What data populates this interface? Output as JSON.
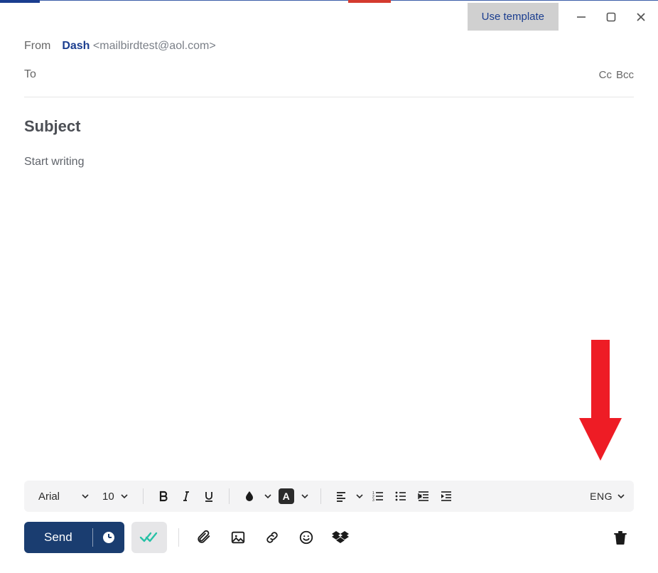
{
  "titlebar": {
    "use_template": "Use template"
  },
  "from": {
    "label": "From",
    "name": "Dash",
    "email": "<mailbirdtest@aol.com>"
  },
  "to": {
    "label": "To",
    "cc": "Cc",
    "bcc": "Bcc"
  },
  "subject": {
    "placeholder": "Subject"
  },
  "body": {
    "placeholder": "Start writing"
  },
  "format": {
    "font": "Arial",
    "size": "10",
    "lang": "ENG"
  },
  "send": {
    "label": "Send"
  }
}
